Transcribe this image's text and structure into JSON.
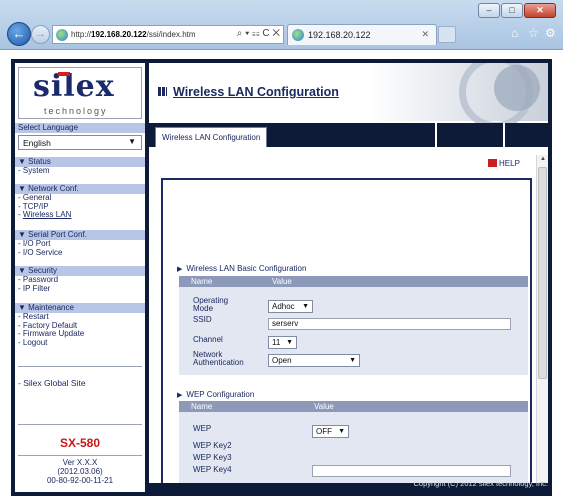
{
  "browser": {
    "address": {
      "prefix": "http://",
      "host": "192.168.20.122",
      "path": "/ssi/index.htm",
      "tools": "⌕ ▾ ☷ C ✕"
    },
    "tab": {
      "title": "192.168.20.122",
      "close": "✕"
    },
    "window_buttons": {
      "minimize": "–",
      "maximize": "□",
      "close": "✕"
    },
    "back": "←",
    "forward": "→",
    "icons": {
      "home": "⌂",
      "favorites": "☆",
      "tools": "⚙"
    }
  },
  "sidebar": {
    "logo": {
      "text": "silex",
      "subtitle": "technology"
    },
    "language": {
      "label": "Select Language",
      "value": "English",
      "arrow": "▼"
    },
    "groups": [
      {
        "heading": "▼ Status",
        "items": [
          {
            "label": "System"
          }
        ]
      },
      {
        "heading": "▼ Network Conf.",
        "items": [
          {
            "label": "General"
          },
          {
            "label": "TCP/IP"
          },
          {
            "label": "Wireless LAN"
          }
        ]
      },
      {
        "heading": "▼ Serial Port Conf.",
        "items": [
          {
            "label": "I/O Port"
          },
          {
            "label": "I/O Service"
          }
        ]
      },
      {
        "heading": "▼ Security",
        "items": [
          {
            "label": "Password"
          },
          {
            "label": "IP Filter"
          }
        ]
      },
      {
        "heading": "▼ Maintenance",
        "items": [
          {
            "label": "Restart"
          },
          {
            "label": "Factory Default"
          },
          {
            "label": "Firmware Update"
          },
          {
            "label": "Logout"
          }
        ]
      }
    ],
    "global_site": "- Silex Global Site",
    "model": "SX-580",
    "version": {
      "line1": "Ver X.X.X",
      "line2": "(2012.03.06)",
      "line3": "00-80-92-00-11-21"
    }
  },
  "main": {
    "title": "Wireless LAN Configuration",
    "tab_label": "Wireless LAN Configuration",
    "help": "HELP",
    "basic": {
      "section_title": "Wireless LAN Basic Configuration",
      "col_name": "Name",
      "col_value": "Value",
      "operating_mode": {
        "label_line1": "Operating",
        "label_line2": "Mode",
        "value": "Adhoc"
      },
      "ssid": {
        "label": "SSID",
        "value": "serserv"
      },
      "channel": {
        "label": "Channel",
        "value": "11"
      },
      "auth": {
        "label_line1": "Network",
        "label_line2": "Authentication",
        "value": "Open"
      }
    },
    "wep": {
      "section_title": "WEP Configuration",
      "col_name": "Name",
      "col_value": "Value",
      "wep": {
        "label": "WEP",
        "value": "OFF"
      },
      "key2": {
        "label": "WEP Key2"
      },
      "key3": {
        "label": "WEP Key3"
      },
      "key4": {
        "label": "WEP Key4"
      }
    },
    "copyright": "Copyright (C) 2012 silex technology, Inc."
  }
}
